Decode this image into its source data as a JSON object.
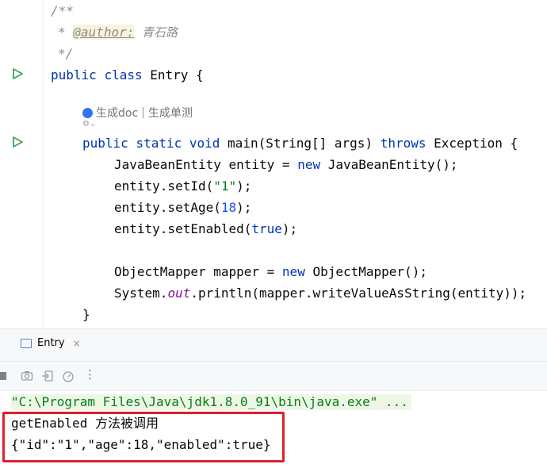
{
  "editor": {
    "lines": {
      "doc_open": "/**",
      "doc_star": "*",
      "doc_tag": "@author:",
      "doc_author": "青石路",
      "doc_close": "*/",
      "class_public": "public",
      "class_kw": "class",
      "class_name": "Entry {",
      "main_public": "public",
      "main_static": "static",
      "main_void": "void",
      "main_sig": "main(String[] args)",
      "main_throws": "throws",
      "main_exc": "Exception {",
      "l1": "JavaBeanEntity entity = ",
      "l1_new": "new",
      "l1_end": " JavaBeanEntity();",
      "l2": "entity.setId(",
      "l2_str": "\"1\"",
      "l2_end": ");",
      "l3": "entity.setAge(",
      "l3_num": "18",
      "l3_end": ");",
      "l4": "entity.setEnabled(",
      "l4_kw": "true",
      "l4_end": ");",
      "l5": "ObjectMapper mapper = ",
      "l5_new": "new",
      "l5_end": " ObjectMapper();",
      "l6": "System.",
      "l6_fld": "out",
      "l6_end": ".println(mapper.writeValueAsString(entity));",
      "close": "}"
    },
    "inlay_hint": {
      "doc": "生成doc",
      "sep": "|",
      "test": "生成单测"
    },
    "colors": {
      "keyword": "#0033b3",
      "string": "#067d17",
      "number": "#1750eb",
      "run": "#3fa35a"
    }
  },
  "run_panel": {
    "tab_label": "Entry",
    "tab_close": "×",
    "output": {
      "command": "\"C:\\Program Files\\Java\\jdk1.8.0_91\\bin\\java.exe\" ...",
      "line1": "getEnabled 方法被调用",
      "line2": "{\"id\":\"1\",\"age\":18,\"enabled\":true}"
    },
    "highlight_color": "#e0202a"
  }
}
